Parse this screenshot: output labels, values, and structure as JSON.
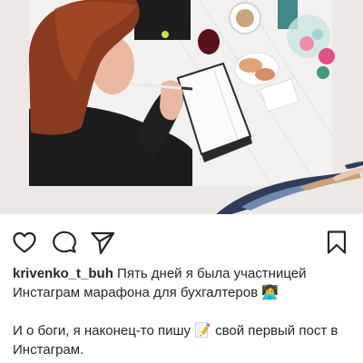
{
  "post": {
    "username": "krivenko_t_buh",
    "caption_line1": "Пять дней я была участницей Инстаграм марафона для бухгалтеров",
    "caption_emoji1": "👩‍💻",
    "caption_line2_before": "И о боги, я наконец-то пишу",
    "caption_emoji2": "📝",
    "caption_line2_after": "свой первый пост в Инстаграм."
  },
  "actions": {
    "like_icon": "heart-icon",
    "comment_icon": "comment-icon",
    "share_icon": "paper-plane-icon",
    "save_icon": "bookmark-icon"
  },
  "colors": {
    "text": "#262626",
    "photo_background": "#ece9e6",
    "accent_navy": "#2f3c5c"
  }
}
